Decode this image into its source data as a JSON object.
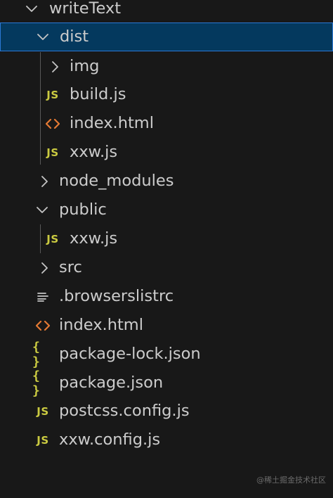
{
  "explorer": {
    "root": {
      "label": "writeText",
      "expanded": true
    },
    "items": [
      {
        "label": "dist",
        "type": "folder",
        "expanded": true,
        "selected": true,
        "icon": "chevron-down-icon"
      },
      {
        "label": "img",
        "type": "folder",
        "expanded": false,
        "icon": "chevron-right-icon"
      },
      {
        "label": "build.js",
        "type": "javascript",
        "icon": "js-file-icon",
        "badge": "JS"
      },
      {
        "label": "index.html",
        "type": "html",
        "icon": "html-file-icon"
      },
      {
        "label": "xxw.js",
        "type": "javascript",
        "icon": "js-file-icon",
        "badge": "JS"
      },
      {
        "label": "node_modules",
        "type": "folder",
        "expanded": false,
        "icon": "chevron-right-icon"
      },
      {
        "label": "public",
        "type": "folder",
        "expanded": true,
        "icon": "chevron-down-icon"
      },
      {
        "label": "xxw.js",
        "type": "javascript",
        "icon": "js-file-icon",
        "badge": "JS"
      },
      {
        "label": "src",
        "type": "folder",
        "expanded": false,
        "icon": "chevron-right-icon"
      },
      {
        "label": ".browserslistrc",
        "type": "config",
        "icon": "lines-file-icon"
      },
      {
        "label": "index.html",
        "type": "html",
        "icon": "html-file-icon"
      },
      {
        "label": "package-lock.json",
        "type": "json",
        "icon": "json-file-icon",
        "badge": "{ }"
      },
      {
        "label": "package.json",
        "type": "json",
        "icon": "json-file-icon",
        "badge": "{ }"
      },
      {
        "label": "postcss.config.js",
        "type": "javascript",
        "icon": "js-file-icon",
        "badge": "JS"
      },
      {
        "label": "xxw.config.js",
        "type": "javascript",
        "icon": "js-file-icon",
        "badge": "JS"
      }
    ]
  },
  "watermark": "@稀土掘金技术社区",
  "colors": {
    "background": "#181818",
    "text": "#cccccc",
    "selection_bg": "#04395e",
    "selection_border": "#2b79d6",
    "js_yellow": "#cbcb41",
    "html_orange": "#e37933",
    "indent_guide": "#585858"
  }
}
